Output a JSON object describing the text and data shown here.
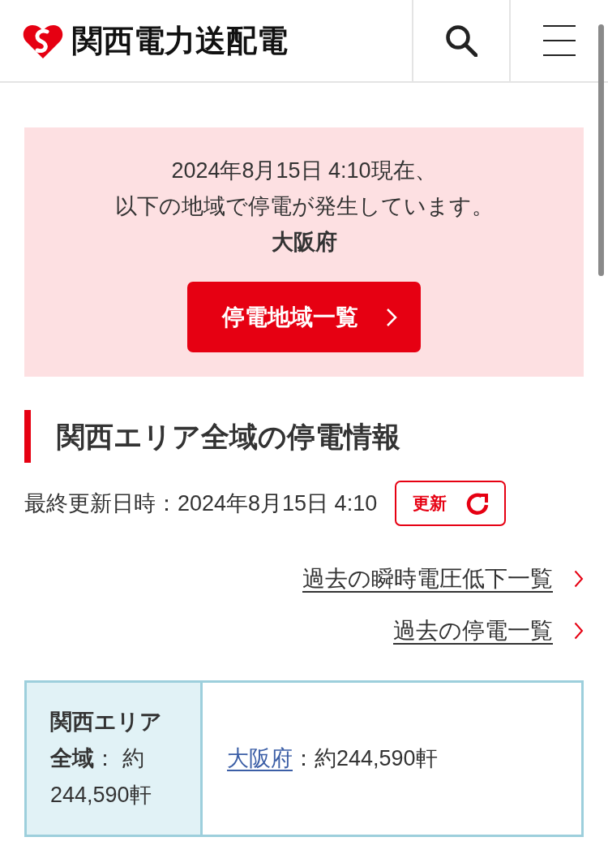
{
  "header": {
    "brand_name": "関西電力送配電"
  },
  "alert": {
    "message_lines": [
      "2024年8月15日 4:10現在、",
      "以下の地域で停電が発生しています。"
    ],
    "region": "大阪府",
    "button": "停電地域一覧"
  },
  "section": {
    "title": "関西エリア全域の停電情報",
    "last_updated": "最終更新日時：2024年8月15日 4:10",
    "refresh_button": "更新"
  },
  "links": [
    {
      "label": "過去の瞬時電圧低下一覧"
    },
    {
      "label": "過去の停電一覧"
    }
  ],
  "summary_table": {
    "total": "**関西エリア全域**： 約 244,590軒",
    "regions": [
      {
        "name": "大阪府",
        "count": "：約244,590軒"
      }
    ]
  }
}
